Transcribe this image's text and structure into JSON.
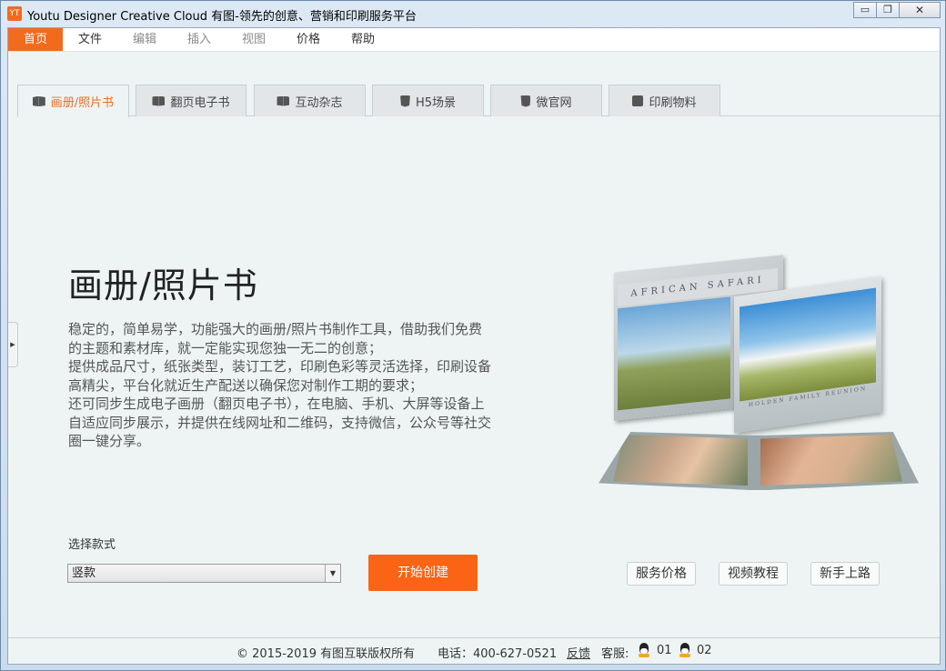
{
  "window": {
    "title": "Youtu Designer Creative Cloud 有图-领先的创意、营销和印刷服务平台",
    "app_icon_text": "YT",
    "minimize_glyph": "▭",
    "restore_glyph": "❐",
    "close_glyph": "✕"
  },
  "menu": [
    {
      "label": "首页",
      "state": "active"
    },
    {
      "label": "文件",
      "state": "normal"
    },
    {
      "label": "编辑",
      "state": "disabled"
    },
    {
      "label": "插入",
      "state": "disabled"
    },
    {
      "label": "视图",
      "state": "disabled"
    },
    {
      "label": "价格",
      "state": "normal"
    },
    {
      "label": "帮助",
      "state": "normal"
    }
  ],
  "tabs": [
    {
      "label": "画册/照片书",
      "icon": "book-icon",
      "active": true
    },
    {
      "label": "翻页电子书",
      "icon": "book-icon",
      "active": false
    },
    {
      "label": "互动杂志",
      "icon": "book-icon",
      "active": false
    },
    {
      "label": "H5场景",
      "icon": "html5-icon",
      "active": false
    },
    {
      "label": "微官网",
      "icon": "html5-icon",
      "active": false
    },
    {
      "label": "印刷物料",
      "icon": "print-icon",
      "active": false
    }
  ],
  "main": {
    "heading": "画册/照片书",
    "description_lines": [
      "稳定的，简单易学，功能强大的画册/照片书制作工具，借助我们免费",
      "的主题和素材库，就一定能实现您独一无二的创意；",
      "提供成品尺寸，纸张类型，装订工艺，印刷色彩等灵活选择，印刷设备",
      "高精尖，平台化就近生产配送以确保您对制作工期的要求；",
      "还可同步生成电子画册（翻页电子书），在电脑、手机、大屏等设备上",
      "自适应同步展示，并提供在线网址和二维码，支持微信，公众号等社交",
      "圈一键分享。"
    ],
    "illustration": {
      "back_book_title": "AFRICAN SAFARI",
      "front_book_caption": "HOLDEN FAMILY REUNION"
    },
    "select_label": "选择款式",
    "select_value": "竖款",
    "select_arrow": "▼",
    "start_button": "开始创建",
    "buttons": [
      "服务价格",
      "视频教程",
      "新手上路"
    ],
    "side_handle_glyph": "▶"
  },
  "footer": {
    "copyright": "© 2015-2019 有图互联版权所有",
    "phone": "电话：400-627-0521",
    "feedback": "反馈",
    "service_label": "客服:",
    "qq1": "01",
    "qq2": "02"
  },
  "colors": {
    "accent": "#fa6414",
    "active_tab_text": "#f26b1d"
  }
}
